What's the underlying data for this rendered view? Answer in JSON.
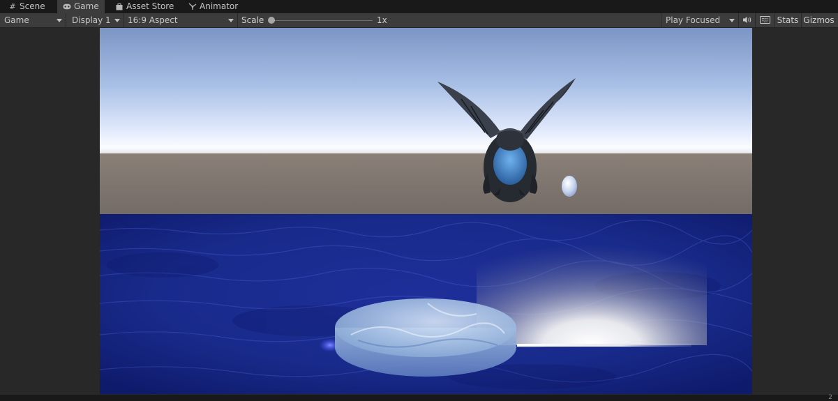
{
  "tabs": [
    {
      "label": "Scene",
      "icon": "grid-icon"
    },
    {
      "label": "Game",
      "icon": "gamepad-icon"
    },
    {
      "label": "Asset Store",
      "icon": "bag-icon"
    },
    {
      "label": "Animator",
      "icon": "animator-icon"
    }
  ],
  "toolbar": {
    "view_mode": "Game",
    "display": "Display 1",
    "aspect": "16:9 Aspect",
    "scale_label": "Scale",
    "scale_value": "1x",
    "scale_slider_level": 0.0,
    "play_mode": "Play Focused",
    "stats_label": "Stats",
    "gizmos_label": "Gizmos"
  },
  "status": {
    "count": "2"
  },
  "colors": {
    "editor_bg": "#282828",
    "toolbar_bg": "#3c3c3c",
    "tabbar_bg": "#191919",
    "sky_top": "#7f98c6",
    "horizon": "#f6f8ff",
    "ground": "#79706a",
    "water": "#1b2a8e"
  }
}
